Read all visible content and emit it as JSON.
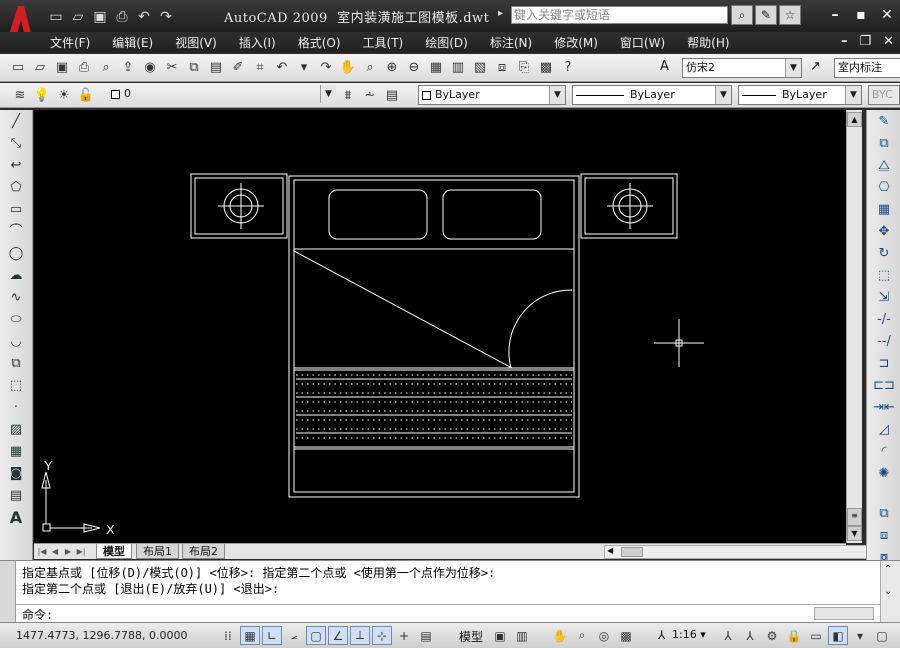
{
  "title": {
    "app": "AutoCAD 2009",
    "document": "室内装潢施工图模板.dwt",
    "search_placeholder": "键入关键字或短语"
  },
  "menu": [
    "文件(F)",
    "编辑(E)",
    "视图(V)",
    "插入(I)",
    "格式(O)",
    "工具(T)",
    "绘图(D)",
    "标注(N)",
    "修改(M)",
    "窗口(W)",
    "帮助(H)"
  ],
  "toolbar": {
    "text_style": "仿宋2",
    "dim_style": "室内标注"
  },
  "layers": {
    "current_layer": "0",
    "color": "ByLayer",
    "linetype": "ByLayer",
    "lineweight": "ByLayer",
    "plot_style": "BYC"
  },
  "ucs": {
    "y_label": "Y",
    "x_label": "X"
  },
  "layout_tabs": {
    "model": "模型",
    "layout1": "布局1",
    "layout2": "布局2"
  },
  "command": {
    "line1": "指定基点或 [位移(D)/模式(O)] <位移>: 指定第二个点或 <使用第一个点作为位移>:",
    "line2": "指定第二个点或 [退出(E)/放弃(U)] <退出>:",
    "prompt": "命令:"
  },
  "status": {
    "coordinates": "1477.4773, 1296.7788, 0.0000",
    "model": "模型",
    "annotation_scale": "1:16"
  }
}
